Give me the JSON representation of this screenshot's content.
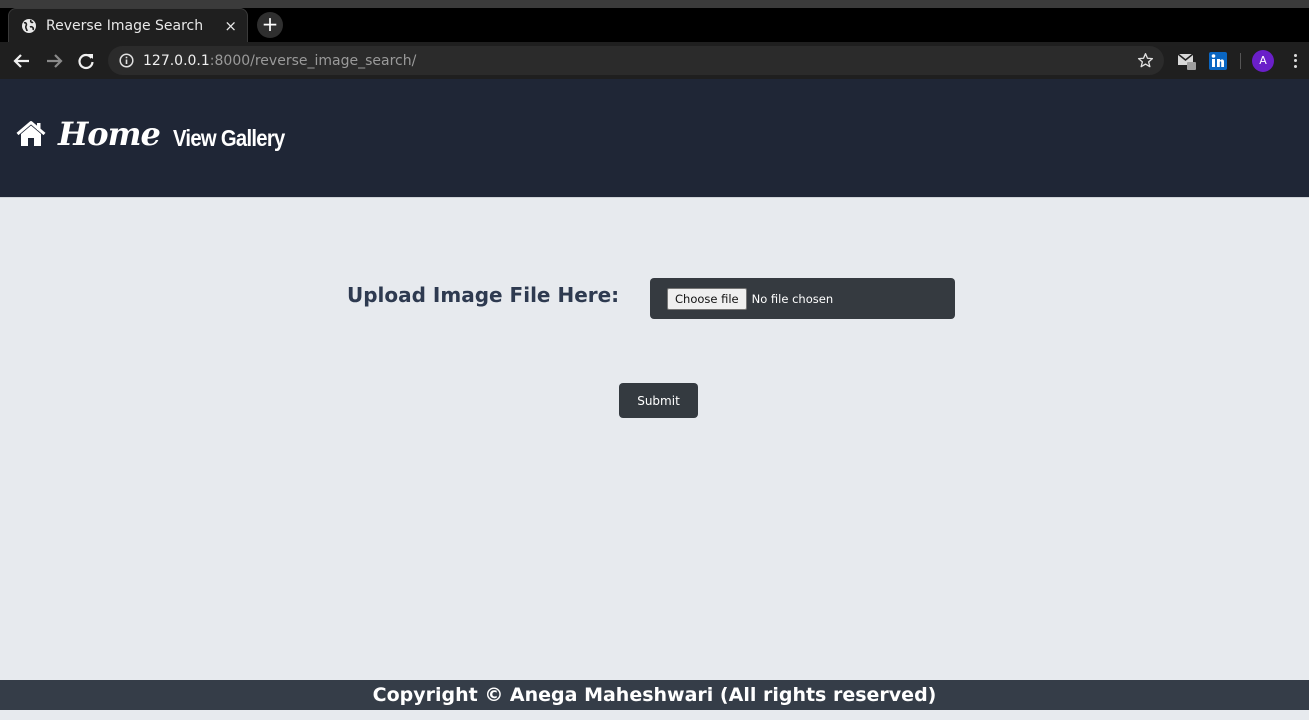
{
  "browser": {
    "tab_title": "Reverse Image Search",
    "tab_close": "×",
    "new_tab": "+",
    "url_host": "127.0.0.1",
    "url_rest": ":8000/reverse_image_search/",
    "profile_initial": "A",
    "icons": [
      "globe-icon",
      "back-icon",
      "forward-icon",
      "reload-icon",
      "info-icon",
      "star-icon",
      "mail-extension-icon",
      "linkedin-icon",
      "menu-icon"
    ]
  },
  "nav": {
    "home_label": "Home",
    "gallery_label": "View Gallery"
  },
  "form": {
    "upload_label": "Upload Image File Here:",
    "choose_file_label": "Choose file",
    "no_file_text": "No file chosen",
    "submit_label": "Submit"
  },
  "footer": {
    "text": "Copyright © Anega Maheshwari (All rights reserved)"
  },
  "colors": {
    "navbar_bg": "#1f2636",
    "page_bg": "#e7eaee",
    "label_color": "#2e3a50",
    "button_bg": "#343a40",
    "footer_bg": "#353d48",
    "avatar_bg": "#6a1fc9"
  }
}
